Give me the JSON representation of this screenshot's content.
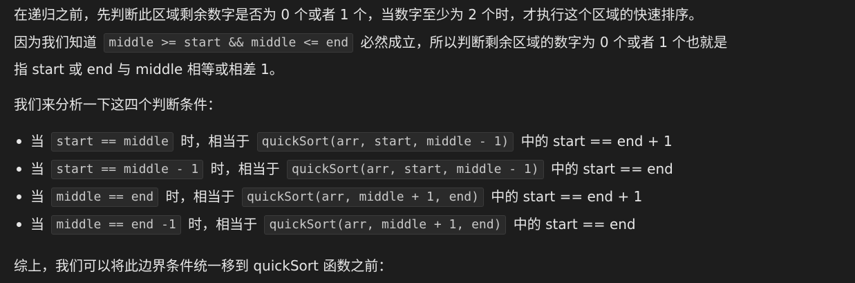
{
  "p1": {
    "line1": "在递归之前，先判断此区域剩余数字是否为 0 个或者 1 个，当数字至少为 2 个时，才执行这个区域的快速排序。",
    "line2_pre": "因为我们知道",
    "line2_code": "middle >= start && middle <= end",
    "line2_post": "必然成立，所以判断剩余区域的数字为 0 个或者 1 个也就是",
    "line3": "指 start 或 end 与 middle 相等或相差 1。"
  },
  "p2": "我们来分析一下这四个判断条件：",
  "bullets": [
    {
      "pre": "当",
      "cond": "start == middle",
      "mid": "时，相当于",
      "call": "quickSort(arr, start, middle - 1)",
      "post": "中的 start == end + 1"
    },
    {
      "pre": "当",
      "cond": "start == middle - 1",
      "mid": "时，相当于",
      "call": "quickSort(arr, start, middle - 1)",
      "post": "中的 start == end"
    },
    {
      "pre": "当",
      "cond": "middle == end",
      "mid": "时，相当于",
      "call": "quickSort(arr, middle + 1, end)",
      "post": "中的 start == end + 1"
    },
    {
      "pre": "当",
      "cond": "middle == end -1",
      "mid": "时，相当于",
      "call": "quickSort(arr, middle + 1, end)",
      "post": "中的 start == end"
    }
  ],
  "p3": "综上，我们可以将此边界条件统一移到 quickSort 函数之前："
}
